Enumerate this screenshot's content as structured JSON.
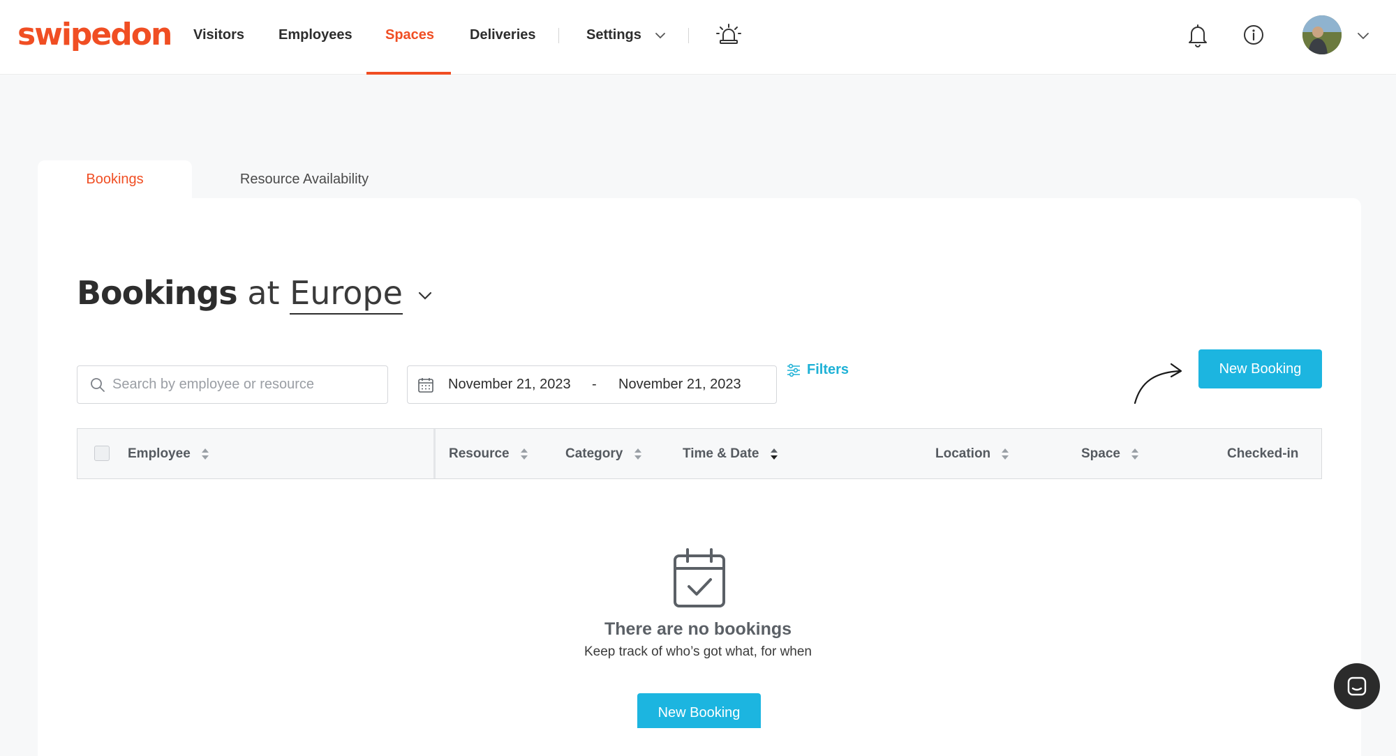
{
  "brand": {
    "logo_text": "swipedon",
    "accent_color": "#f04e23",
    "primary_button_color": "#1cb5e0"
  },
  "nav": {
    "items": [
      {
        "label": "Visitors"
      },
      {
        "label": "Employees"
      },
      {
        "label": "Spaces",
        "active": true
      },
      {
        "label": "Deliveries"
      },
      {
        "label": "Settings"
      }
    ],
    "icons": [
      "emergency-alarm-icon",
      "bell-icon",
      "info-icon",
      "avatar",
      "chevron-down-icon"
    ]
  },
  "tabs": [
    {
      "label": "Bookings",
      "active": true
    },
    {
      "label": "Resource Availability",
      "active": false
    }
  ],
  "page": {
    "title_strong": "Bookings",
    "title_at": "at",
    "location": "Europe"
  },
  "search": {
    "placeholder": "Search by employee or resource"
  },
  "date_range": {
    "start": "November 21, 2023",
    "separator": "-",
    "end": "November 21, 2023"
  },
  "filters_label": "Filters",
  "new_booking_label": "New Booking",
  "table": {
    "columns": [
      {
        "label": "Employee"
      },
      {
        "label": "Resource"
      },
      {
        "label": "Category"
      },
      {
        "label": "Time & Date"
      },
      {
        "label": "Location"
      },
      {
        "label": "Space"
      },
      {
        "label": "Checked-in"
      }
    ],
    "rows": []
  },
  "empty_state": {
    "title": "There are no bookings",
    "subtitle": "Keep track of who’s got what, for when",
    "button_label": "New Booking"
  }
}
